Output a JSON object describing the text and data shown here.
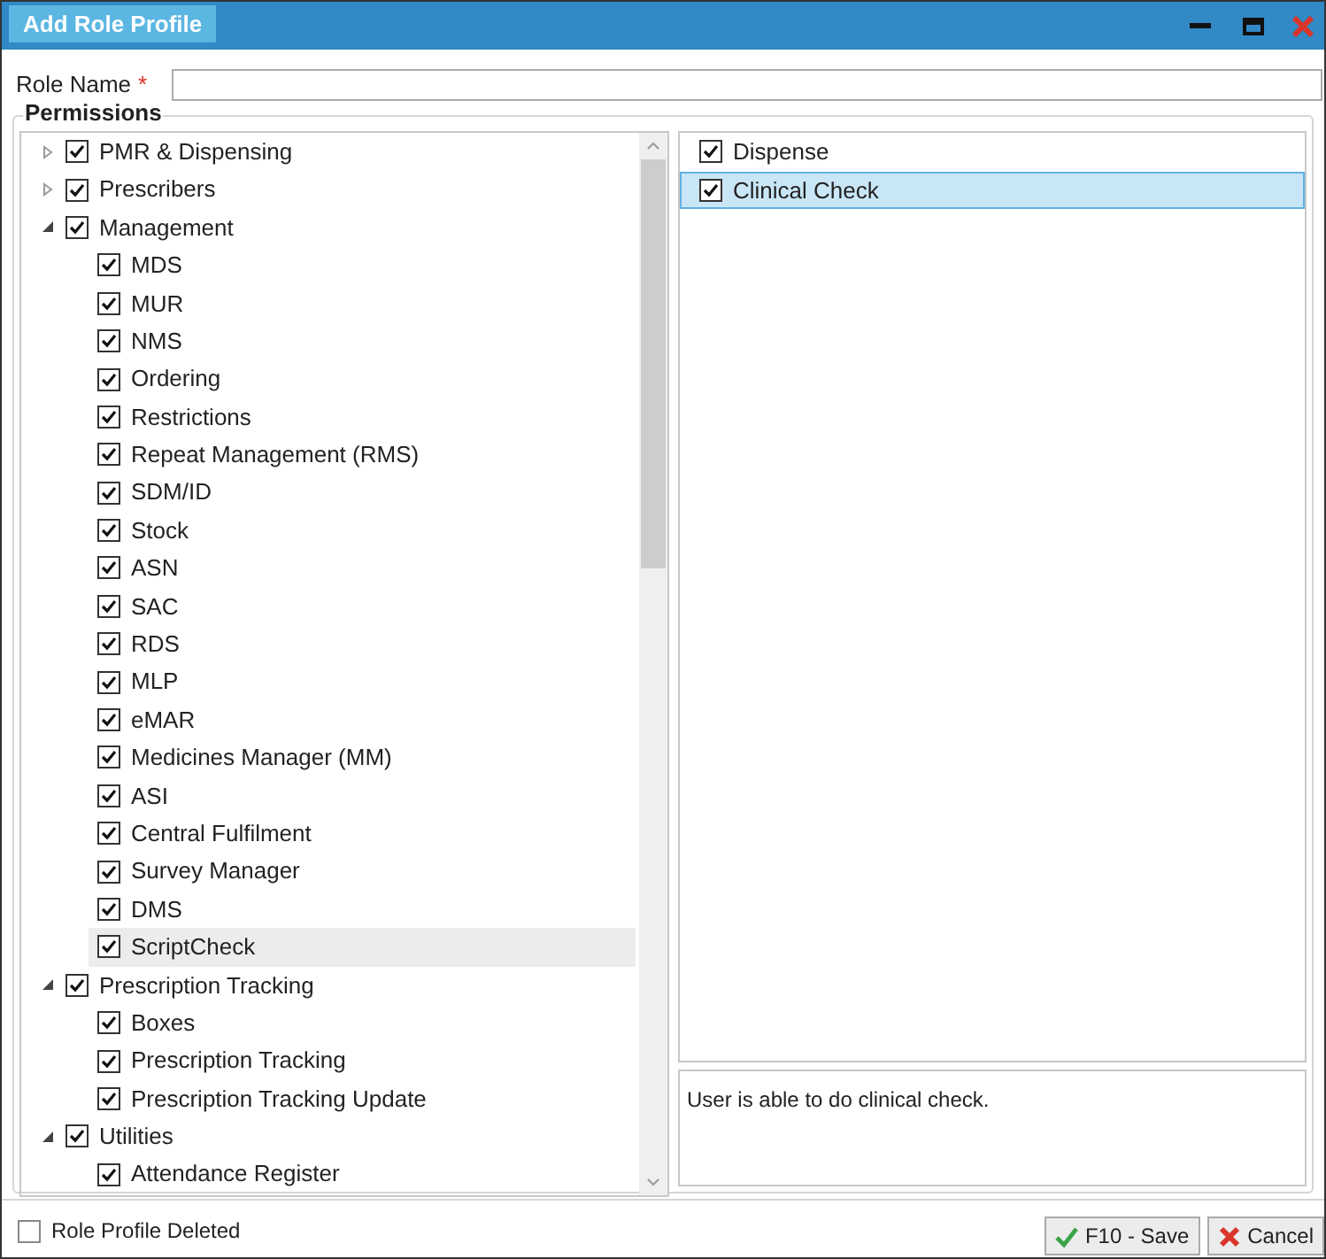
{
  "window": {
    "title": "Add Role Profile"
  },
  "role_name": {
    "label": "Role Name",
    "required_mark": "*"
  },
  "permissions": {
    "label": "Permissions",
    "tree": [
      {
        "label": "PMR & Dispensing",
        "checked": true,
        "expanded": false,
        "selected": false
      },
      {
        "label": "Prescribers",
        "checked": true,
        "expanded": false,
        "selected": false
      },
      {
        "label": "Management",
        "checked": true,
        "expanded": true,
        "selected": false,
        "children": [
          {
            "label": "MDS",
            "checked": true,
            "selected": false
          },
          {
            "label": "MUR",
            "checked": true,
            "selected": false
          },
          {
            "label": "NMS",
            "checked": true,
            "selected": false
          },
          {
            "label": "Ordering",
            "checked": true,
            "selected": false
          },
          {
            "label": "Restrictions",
            "checked": true,
            "selected": false
          },
          {
            "label": "Repeat Management (RMS)",
            "checked": true,
            "selected": false
          },
          {
            "label": "SDM/ID",
            "checked": true,
            "selected": false
          },
          {
            "label": "Stock",
            "checked": true,
            "selected": false
          },
          {
            "label": "ASN",
            "checked": true,
            "selected": false
          },
          {
            "label": "SAC",
            "checked": true,
            "selected": false
          },
          {
            "label": "RDS",
            "checked": true,
            "selected": false
          },
          {
            "label": "MLP",
            "checked": true,
            "selected": false
          },
          {
            "label": "eMAR",
            "checked": true,
            "selected": false
          },
          {
            "label": "Medicines Manager (MM)",
            "checked": true,
            "selected": false
          },
          {
            "label": "ASI",
            "checked": true,
            "selected": false
          },
          {
            "label": "Central Fulfilment",
            "checked": true,
            "selected": false
          },
          {
            "label": "Survey Manager",
            "checked": true,
            "selected": false
          },
          {
            "label": "DMS",
            "checked": true,
            "selected": false
          },
          {
            "label": "ScriptCheck",
            "checked": true,
            "selected": true
          }
        ]
      },
      {
        "label": "Prescription Tracking",
        "checked": true,
        "expanded": true,
        "selected": false,
        "children": [
          {
            "label": "Boxes",
            "checked": true,
            "selected": false
          },
          {
            "label": "Prescription Tracking",
            "checked": true,
            "selected": false
          },
          {
            "label": "Prescription Tracking Update",
            "checked": true,
            "selected": false
          }
        ]
      },
      {
        "label": "Utilities",
        "checked": true,
        "expanded": true,
        "selected": false,
        "children": [
          {
            "label": "Attendance Register",
            "checked": true,
            "selected": false
          }
        ]
      }
    ]
  },
  "detail_list": [
    {
      "label": "Dispense",
      "checked": true,
      "selected": false
    },
    {
      "label": "Clinical Check",
      "checked": true,
      "selected": true
    }
  ],
  "description": "User is able to do clinical check.",
  "role_profile_deleted": {
    "label": "Role Profile Deleted",
    "checked": false
  },
  "buttons": [
    {
      "label": "F10 - Save",
      "kind": "save"
    },
    {
      "label": "Cancel",
      "kind": "cancel"
    }
  ]
}
